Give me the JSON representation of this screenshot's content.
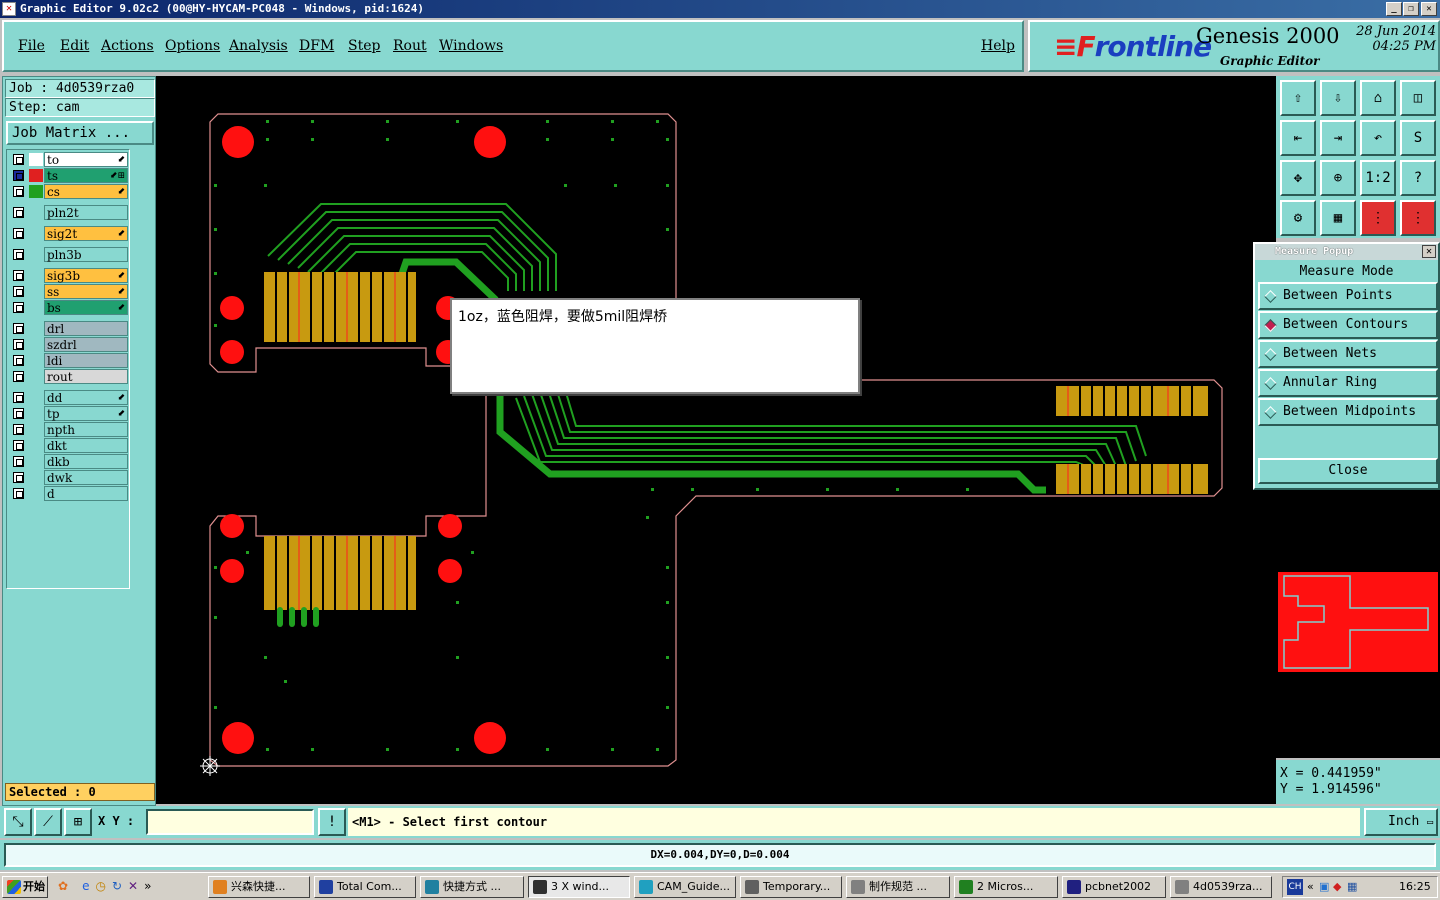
{
  "window": {
    "title": "Graphic Editor 9.02c2 (00@HY-HYCAM-PC048 - Windows, pid:1624)"
  },
  "menu": [
    "File",
    "Edit",
    "Actions",
    "Options",
    "Analysis",
    "DFM",
    "Step",
    "Rout",
    "Windows"
  ],
  "help": "Help",
  "brand": {
    "logo_pre": "≡F",
    "logo_rest": "rontline",
    "product": "Genesis 2000",
    "subtitle": "Graphic Editor",
    "date": "28 Jun 2014",
    "time": "04:25 PM"
  },
  "job": {
    "job": "Job : 4d0539rza0",
    "step": "Step: cam",
    "matrix": "Job Matrix ..."
  },
  "layers": [
    {
      "name": "to",
      "color": "#ffffff",
      "bg": "#ffffff",
      "arrow": "⬋"
    },
    {
      "name": "ts",
      "color": "#e02020",
      "bg": "#20a070",
      "arrow": "⬋⊞"
    },
    {
      "name": "cs",
      "color": "#20a020",
      "bg": "#ffc040",
      "arrow": "⬋"
    },
    {
      "name": "pln2t",
      "color": "",
      "bg": "#88d8d0",
      "arrow": ""
    },
    {
      "name": "sig2t",
      "color": "",
      "bg": "#ffc040",
      "arrow": "⬋"
    },
    {
      "name": "pln3b",
      "color": "",
      "bg": "#88d8d0",
      "arrow": ""
    },
    {
      "name": "sig3b",
      "color": "",
      "bg": "#ffc040",
      "arrow": "⬋"
    },
    {
      "name": "ss",
      "color": "",
      "bg": "#ffc040",
      "arrow": "⬋"
    },
    {
      "name": "bs",
      "color": "",
      "bg": "#20a070",
      "arrow": "⬋"
    },
    {
      "name": "drl",
      "color": "",
      "bg": "#a0b8c0",
      "arrow": ""
    },
    {
      "name": "szdrl",
      "color": "",
      "bg": "#a0b8c0",
      "arrow": ""
    },
    {
      "name": "ldi",
      "color": "",
      "bg": "#a0b8c0",
      "arrow": ""
    },
    {
      "name": "rout",
      "color": "",
      "bg": "#d8d8d8",
      "arrow": ""
    },
    {
      "name": "dd",
      "color": "",
      "bg": "#88d8d0",
      "arrow": "⬋"
    },
    {
      "name": "tp",
      "color": "",
      "bg": "#88d8d0",
      "arrow": "⬋"
    },
    {
      "name": "npth",
      "color": "",
      "bg": "#88d8d0",
      "arrow": ""
    },
    {
      "name": "dkt",
      "color": "",
      "bg": "#88d8d0",
      "arrow": ""
    },
    {
      "name": "dkb",
      "color": "",
      "bg": "#88d8d0",
      "arrow": ""
    },
    {
      "name": "dwk",
      "color": "",
      "bg": "#88d8d0",
      "arrow": ""
    },
    {
      "name": "d",
      "color": "",
      "bg": "#88d8d0",
      "arrow": ""
    }
  ],
  "selected": "Selected : 0",
  "note": "1oz，蓝色阻焊，要做5mil阻焊桥",
  "toolbar_icons": [
    "edit-icon",
    "save-icon",
    "home-icon",
    "window-icon",
    "arrow-left-icon",
    "arrow-right-icon",
    "undo-icon",
    "snap-icon",
    "fit-icon",
    "zoom-icon",
    "1:2",
    "help-icon",
    "settings-icon",
    "grid-icon",
    "net-icon",
    "net-red-icon"
  ],
  "measure": {
    "title": "Measure Popup",
    "mode": "Measure Mode",
    "options": [
      "Between Points",
      "Between Contours",
      "Between Nets",
      "Annular Ring",
      "Between Midpoints"
    ],
    "selected": 1,
    "close": "Close"
  },
  "coords": {
    "x": "X  =  0.441959\"",
    "y": "Y  =  1.914596\""
  },
  "cmd": {
    "xy_label": "X Y :",
    "xy_value": "",
    "message": "<M1> - Select first contour",
    "unit": "Inch"
  },
  "status": "DX=0.004,DY=0,D=0.004",
  "taskbar": {
    "start": "开始",
    "items": [
      "兴森快捷...",
      "Total Com...",
      "快捷方式 ...",
      "3 X wind...",
      "CAM_Guide...",
      "Temporary...",
      "制作规范 ...",
      "2 Micros...",
      "pcbnet2002",
      "4d0539rza..."
    ],
    "lang": "CH",
    "clock": "16:25"
  }
}
